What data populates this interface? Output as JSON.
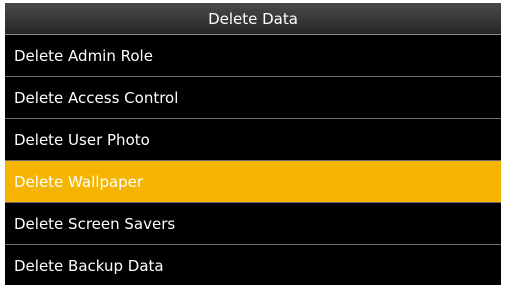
{
  "header": {
    "title": "Delete Data"
  },
  "menu": {
    "items": [
      {
        "label": "Delete Admin Role",
        "selected": false
      },
      {
        "label": "Delete Access Control",
        "selected": false
      },
      {
        "label": "Delete User Photo",
        "selected": false
      },
      {
        "label": "Delete Wallpaper",
        "selected": true
      },
      {
        "label": "Delete Screen Savers",
        "selected": false
      },
      {
        "label": "Delete Backup Data",
        "selected": false
      }
    ]
  },
  "colors": {
    "background": "#000000",
    "highlight": "#f5b400",
    "text": "#ffffff",
    "divider": "#6e6e6e"
  }
}
